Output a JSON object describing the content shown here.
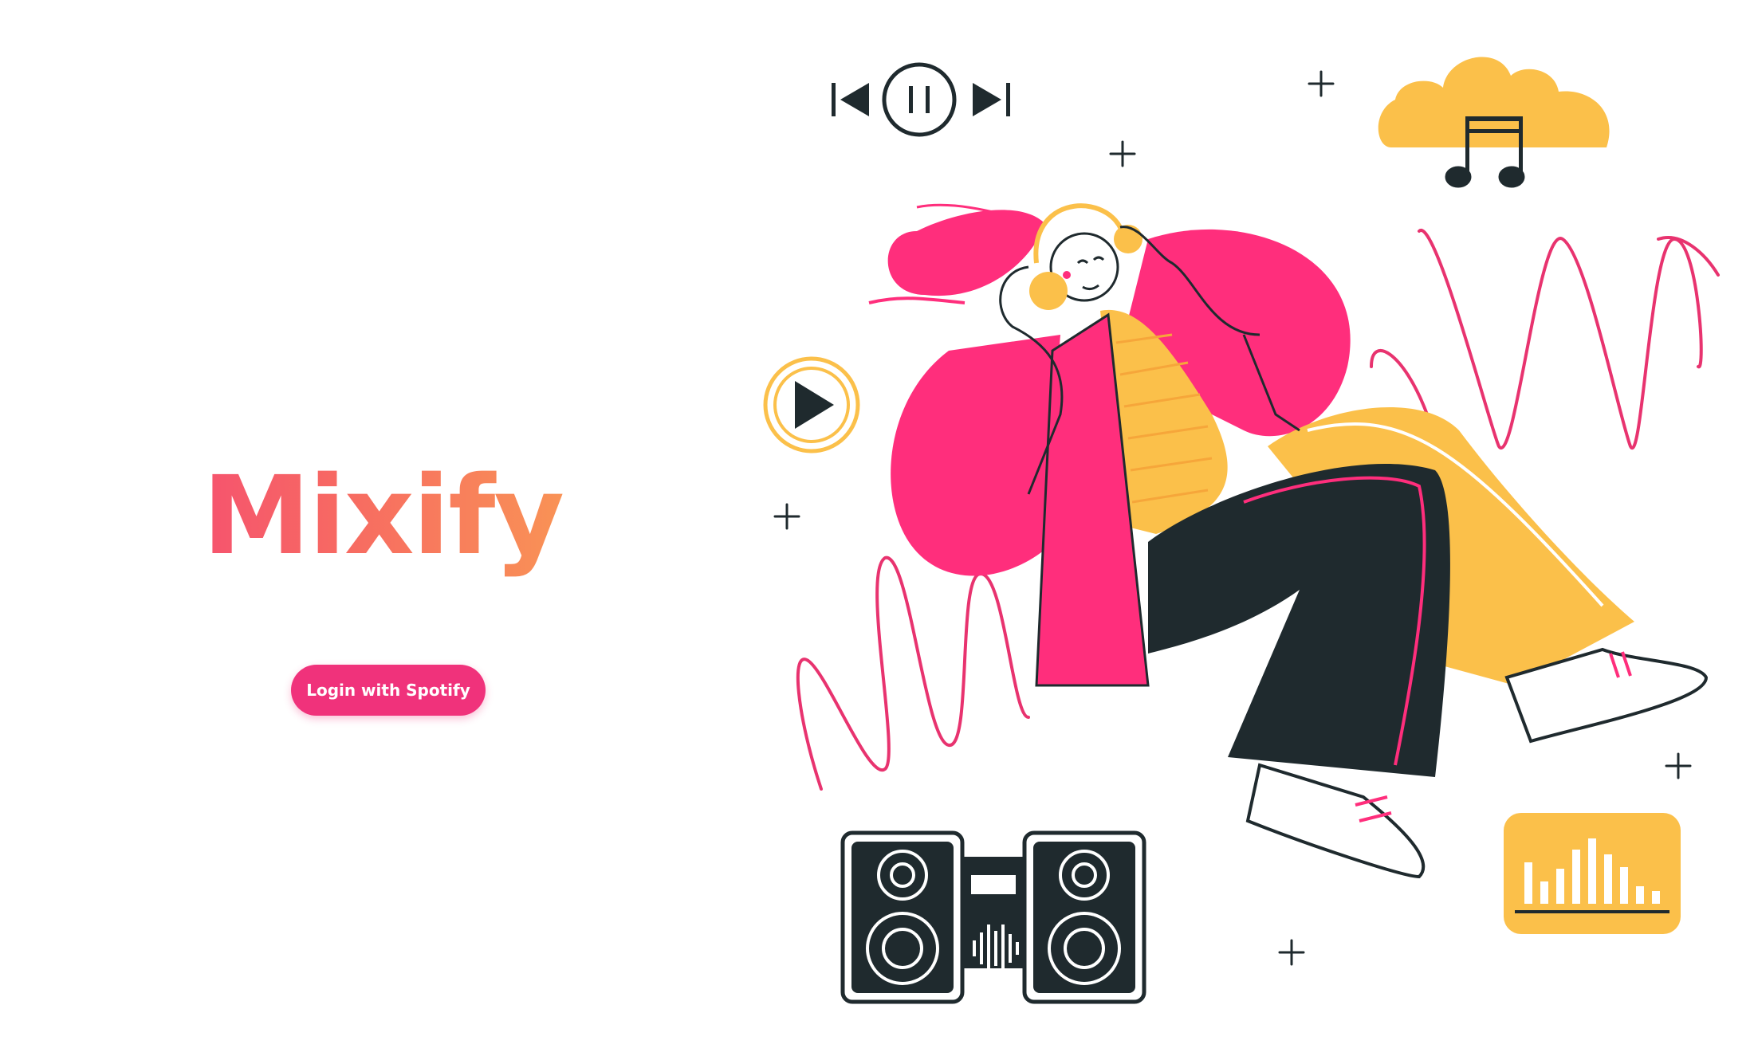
{
  "app": {
    "title": "Mixify"
  },
  "login": {
    "label": "Login with Spotify"
  },
  "colors": {
    "accent_pink": "#F0327B",
    "gradient_start": "#F4347F",
    "gradient_end": "#FBB84A",
    "illustration_yellow": "#FBC04A",
    "illustration_dark": "#1F2A2E"
  },
  "illustration": {
    "icons": [
      "skip-previous-icon",
      "pause-icon",
      "skip-next-icon",
      "play-icon",
      "music-cloud-icon",
      "equalizer-icon",
      "stereo-speaker-icon",
      "sparkle-icon"
    ]
  }
}
